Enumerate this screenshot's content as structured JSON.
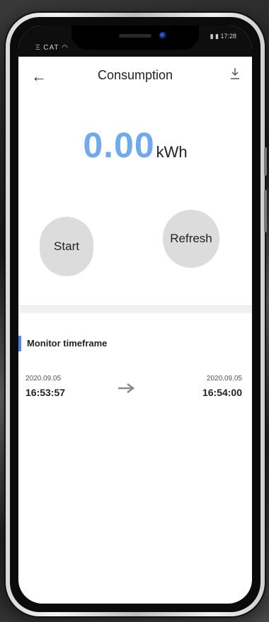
{
  "status": {
    "left": "Ξ CAT ◠",
    "right": "▮ ▮ 17:28"
  },
  "appbar": {
    "title": "Consumption",
    "back_icon": "arrow-left-icon",
    "download_icon": "download-icon"
  },
  "reading": {
    "value": "0.00",
    "unit": "kWh",
    "value_color": "#6fa9ee"
  },
  "buttons": {
    "start_label": "Start",
    "refresh_label": "Refresh"
  },
  "monitor": {
    "title": "Monitor timeframe",
    "accent_color": "#4f86e5",
    "start_date": "2020.09.05",
    "start_time": "16:53:57",
    "end_date": "2020.09.05",
    "end_time": "16:54:00",
    "arrow_icon": "arrow-right-icon"
  }
}
